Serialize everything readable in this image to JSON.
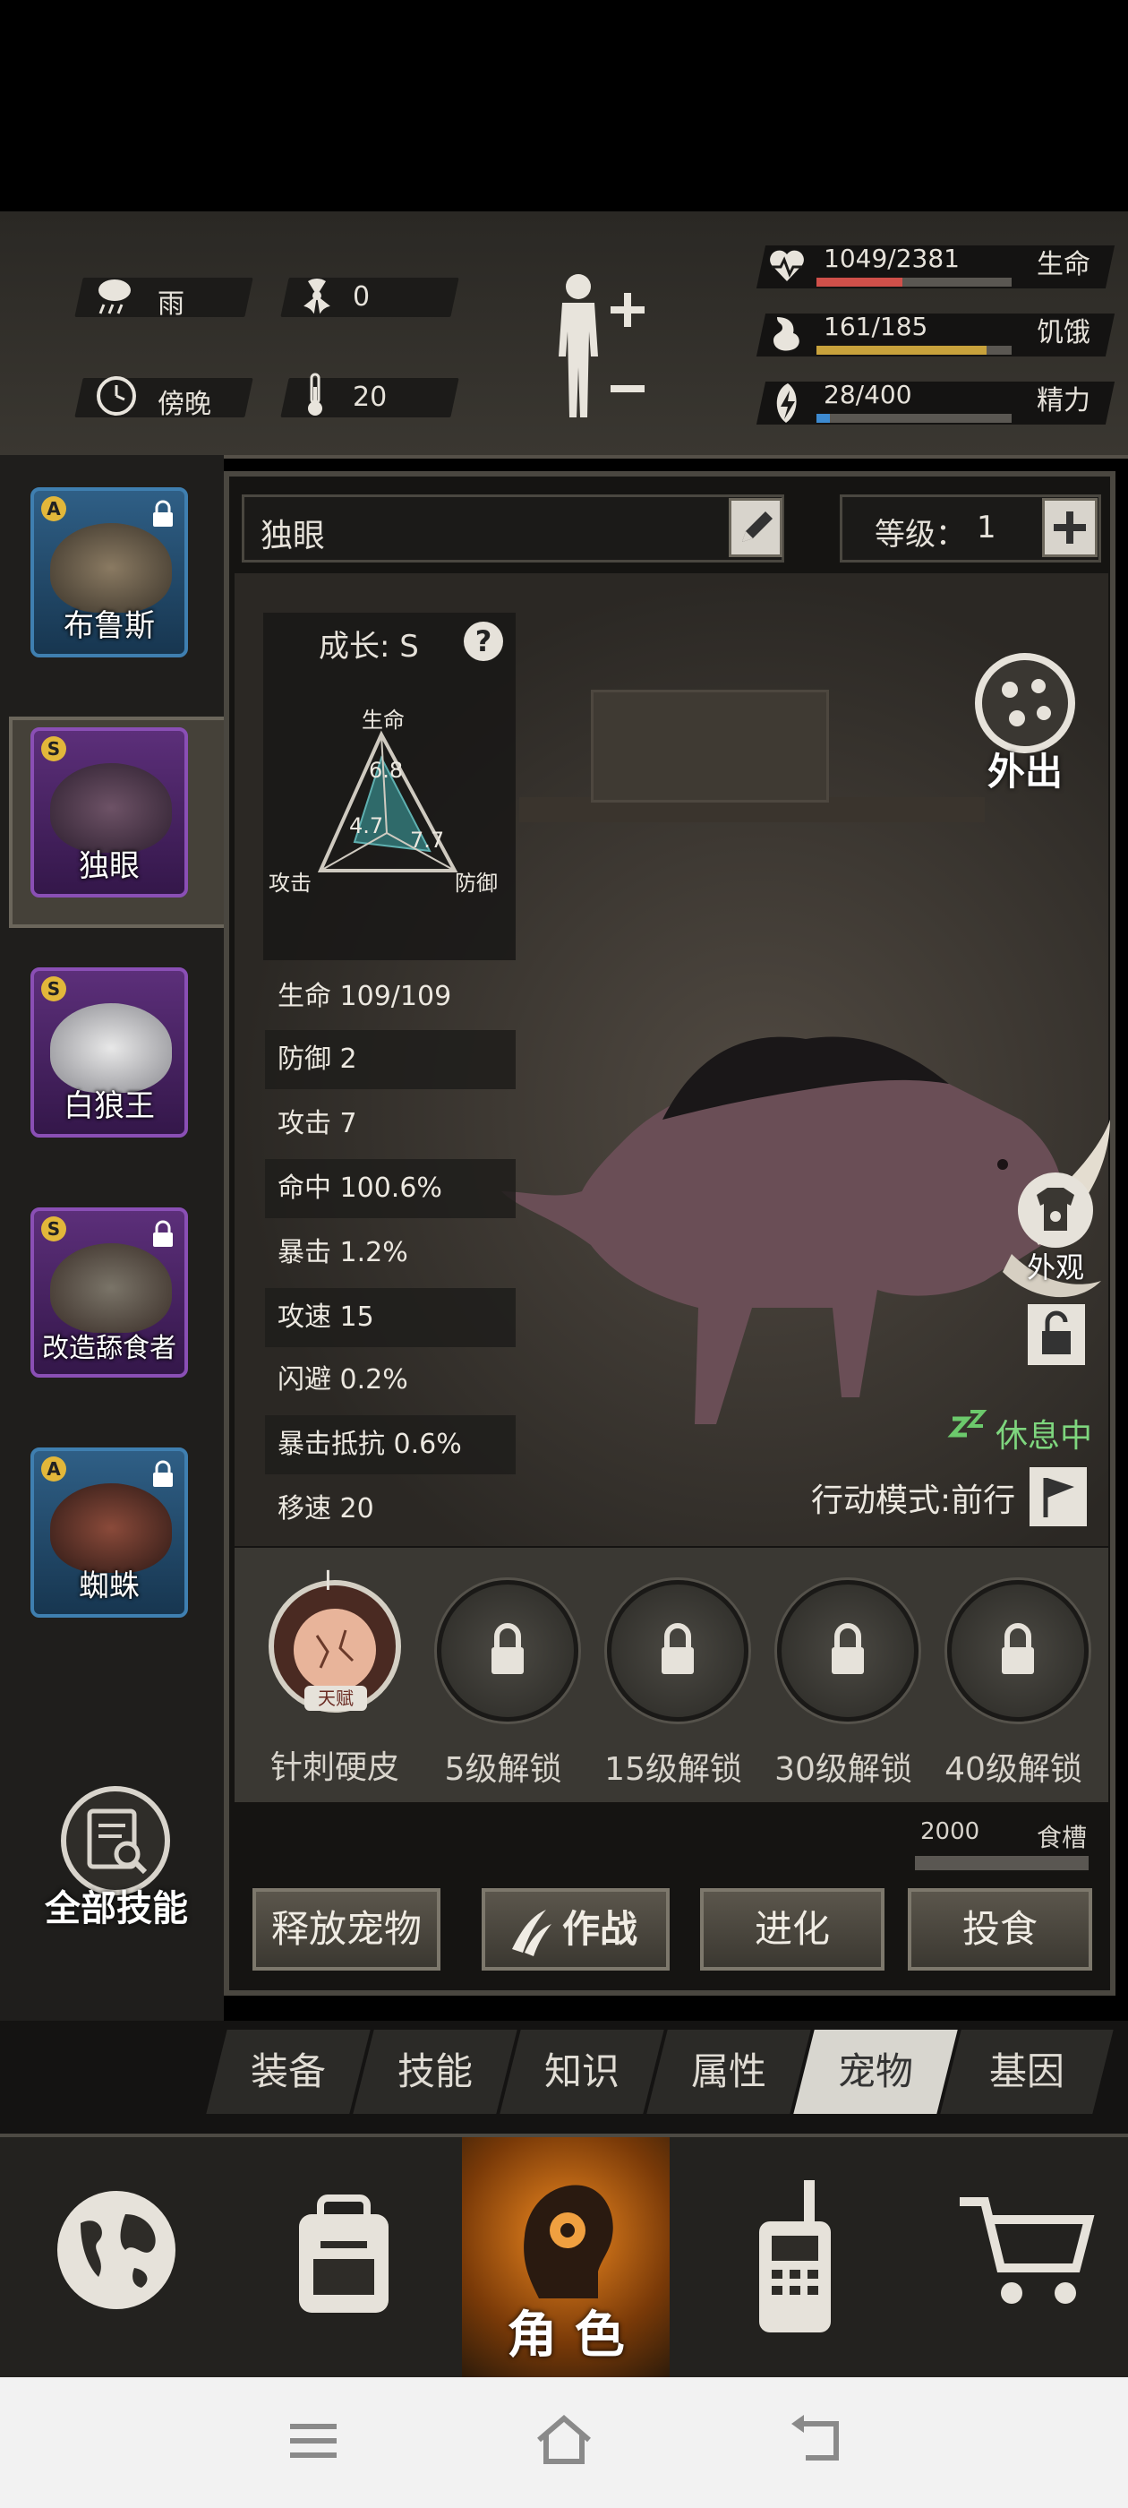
{
  "status": {
    "weather": "雨",
    "radiation": "0",
    "time_of_day": "傍晚",
    "temperature": "20",
    "stats": [
      {
        "value": "1049/2381",
        "label": "生命",
        "fill": 0.44,
        "color": "#d0504a"
      },
      {
        "value": "161/185",
        "label": "饥饿",
        "fill": 0.87,
        "color": "#c8a23c"
      },
      {
        "value": "28/400",
        "label": "精力",
        "fill": 0.07,
        "color": "#3d8ad0"
      }
    ]
  },
  "pets": [
    {
      "name": "布鲁斯",
      "grade": "A",
      "locked": true,
      "rarity": "blue"
    },
    {
      "name": "独眼",
      "grade": "S",
      "locked": false,
      "rarity": "purple",
      "selected": true
    },
    {
      "name": "白狼王",
      "grade": "S",
      "locked": false,
      "rarity": "purple"
    },
    {
      "name": "改造舔食者",
      "grade": "S",
      "locked": true,
      "rarity": "purple"
    },
    {
      "name": "蜘蛛",
      "grade": "A",
      "locked": true,
      "rarity": "blue"
    }
  ],
  "all_skills_label": "全部技能",
  "pet_detail": {
    "name": "独眼",
    "level_label": "等级：",
    "level": "1",
    "growth_label": "成长: S",
    "radar": {
      "top_label": "生命",
      "left_label": "攻击",
      "right_label": "防御",
      "top_value": "6.8",
      "left_value": "4.7",
      "right_value": "7.7"
    },
    "stats": [
      "生命  109/109",
      "防御  2",
      "攻击  7",
      "命中  100.6%",
      "暴击  1.2%",
      "攻速  15",
      "闪避  0.2%",
      "暴击抵抗  0.6%",
      "移速  20"
    ],
    "go_out_label": "外出",
    "appearance_label": "外观",
    "status_text": "休息中",
    "action_mode": "行动模式:前行"
  },
  "skills": {
    "talent_badge": "天赋",
    "talent_roman": "I",
    "labels": [
      "针刺硬皮",
      "5级解锁",
      "15级解锁",
      "30级解锁",
      "40级解锁"
    ]
  },
  "food": {
    "value": "2000",
    "label": "食槽"
  },
  "actions": [
    "释放宠物",
    "作战",
    "进化",
    "投食"
  ],
  "tabs": [
    "装备",
    "技能",
    "知识",
    "属性",
    "宠物",
    "基因"
  ],
  "active_tab": "宠物",
  "nav": {
    "character_label": "角 色"
  }
}
